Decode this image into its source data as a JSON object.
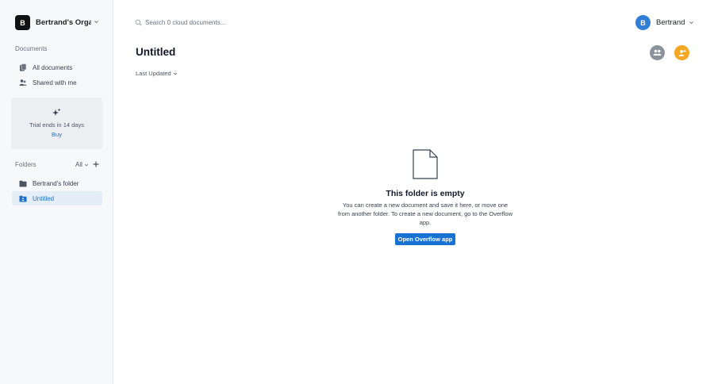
{
  "sidebar": {
    "org": {
      "initial": "B",
      "name": "Bertrand's Orga..."
    },
    "documents_label": "Documents",
    "nav": [
      {
        "label": "All documents",
        "icon": "documents-icon"
      },
      {
        "label": "Shared with me",
        "icon": "shared-users-icon"
      }
    ],
    "trial": {
      "text": "Trial ends in 14 days",
      "buy_label": "Buy",
      "icon": "sparkle-icon"
    },
    "folders": {
      "label": "Folders",
      "filter_label": "All",
      "items": [
        {
          "label": "Bertrand's folder",
          "icon": "folder-icon",
          "active": false
        },
        {
          "label": "Untitled",
          "icon": "folder-shared-icon",
          "active": true
        }
      ]
    }
  },
  "header": {
    "search_placeholder": "Search 0 cloud documents...",
    "user": {
      "initial": "B",
      "name": "Bertrand"
    }
  },
  "main": {
    "title": "Untitled",
    "sort_label": "Last Updated",
    "actions": [
      {
        "name": "share-members-button",
        "icon": "users-icon",
        "color": "#8c939c"
      },
      {
        "name": "invite-button",
        "icon": "user-add-icon",
        "color": "#f5a623"
      }
    ],
    "empty_state": {
      "icon": "document-icon",
      "title": "This folder is empty",
      "description": "You can create a new document and save it here, or move one from another folder. To create a new document, go to the Overflow app.",
      "button_label": "Open Overflow app"
    }
  },
  "colors": {
    "accent": "#1872d3",
    "sidebar_bg": "#f7f8f9",
    "active_bg": "#e5eef8"
  }
}
